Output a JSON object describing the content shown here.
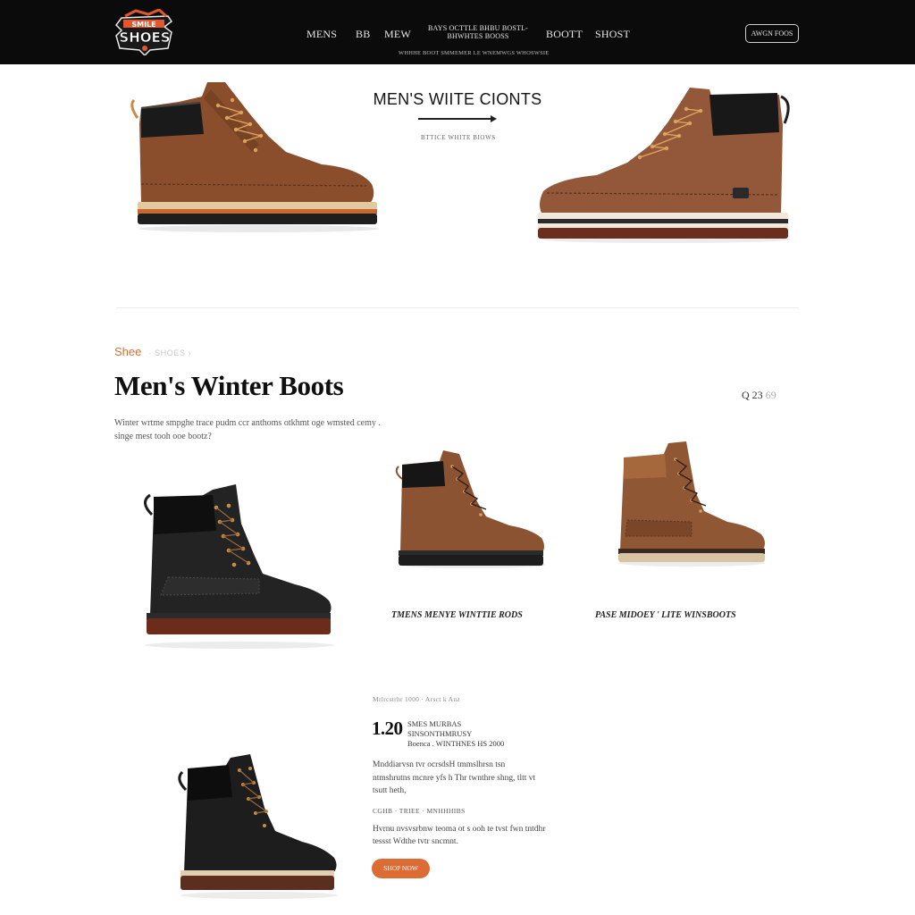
{
  "header": {
    "logo_text": "SHOES",
    "nav": [
      {
        "label": "MENS"
      },
      {
        "label": "BB"
      },
      {
        "label": "MEW"
      },
      {
        "label": "BAYS OCTTLE BHBU BOSTL-BHWHTES BOOSS"
      },
      {
        "label": "BOOTT"
      },
      {
        "label": "SHOST"
      }
    ],
    "subnav_text": "WHHHE BOOT SMMEMER LE WNEMWGS WHOSWSIE",
    "button_label": "AWGN FOOS"
  },
  "hero": {
    "title": "MEN'S WIITE CIONTS",
    "subtitle": "BTTICE WHITE BIOWS"
  },
  "main": {
    "breadcrumb": "Shee",
    "breadcrumb_rest": "· SHOES ›",
    "title": "Men's Winter  Boots",
    "price_tag": "Q 23",
    "price_tag_dim": "69",
    "intro": "Winter wrtme smpghe trace pudm ccr anthoms otkhmt oge wmsted cemy . singe mest tooh ooe bootz?"
  },
  "products": [
    {
      "label": "TMENS MENYE WINTTIE RODS"
    },
    {
      "label": "PASE MIDOEY ' LITE WINSBOOTS"
    }
  ],
  "detail": {
    "meta": "Mrlrcstrhr 1000 · Arsct k Anz",
    "price": "1.20",
    "price_note_1": "SMES MURBAS  SINSONTHMRUSY",
    "price_note_2": "Boenca . WINTHNES HS 2000",
    "body": "Mnddiarvsn tvr ocrsdsH tmmslhrsn tsn ntmshrutns mcnre yfs h Thr twnthre shng, tltt vt tsutt heth,",
    "subheading": "CGHB · TRIEE · MNHHHIBS",
    "body2": "Hvrnu nvsvsrbnw teoma ot s ooh te tvst fwn tntdhr tessst Wdthe tvtr sncmnt.",
    "cta_label": "SHOP NOW"
  },
  "colors": {
    "accent": "#dd6b34",
    "header_bg": "#0b0b0b",
    "boot_brown": "#8a4e2c",
    "boot_black": "#1c1c1c"
  }
}
